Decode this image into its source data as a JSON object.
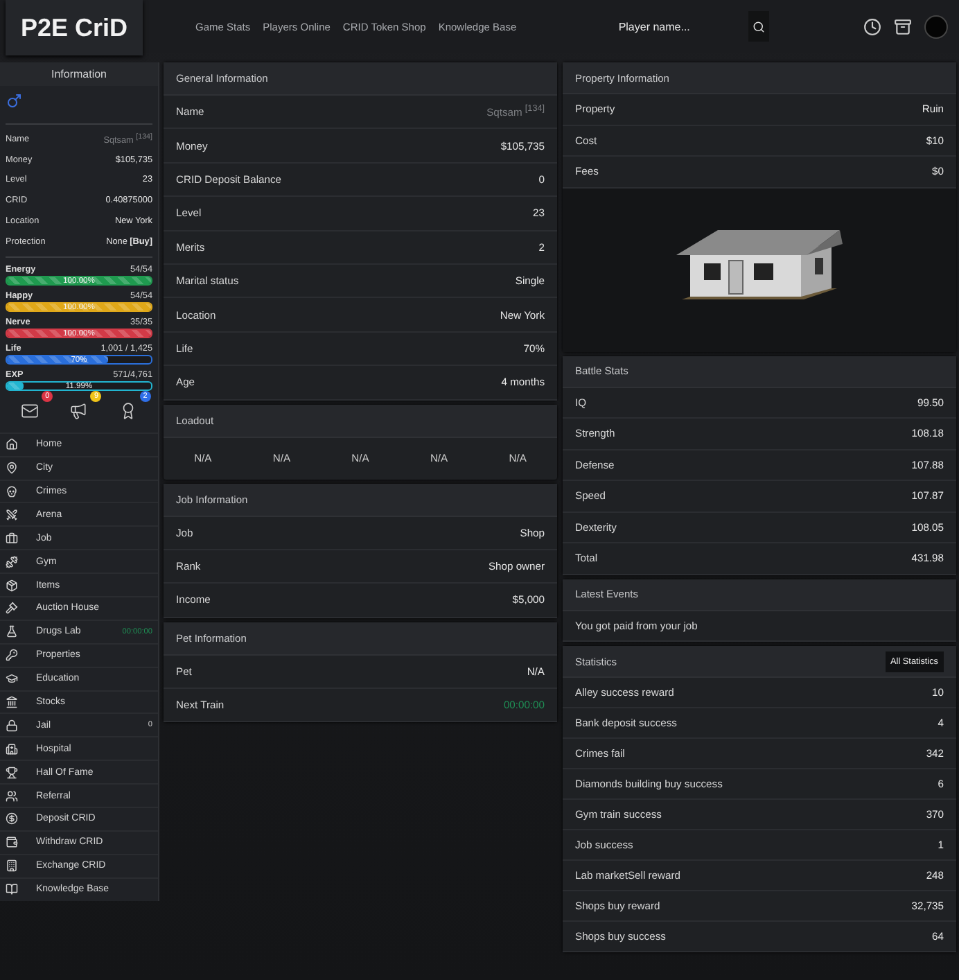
{
  "topbar": {
    "logo": "P2E CriD",
    "nav": [
      "Game Stats",
      "Players Online",
      "CRID Token Shop",
      "Knowledge Base"
    ],
    "search": {
      "placeholder": "Player name..."
    }
  },
  "sidebar": {
    "title": "Information",
    "info": [
      {
        "label": "Name",
        "value": "Sqtsam $^{[134]}$",
        "kind": "muted"
      },
      {
        "label": "Money",
        "value": "$105,735",
        "kind": "plain"
      },
      {
        "label": "Level",
        "value": "23",
        "kind": "plain"
      },
      {
        "label": "CRID",
        "value": "0.40875000",
        "kind": "plain"
      },
      {
        "label": "Location",
        "value": "New York",
        "kind": "plain"
      },
      {
        "label": "Protection",
        "value": "None **[Buy]**",
        "kind": "plain"
      }
    ],
    "bars": [
      {
        "label": "Energy",
        "reading": "54/54",
        "percent": "100.00%",
        "level": 1,
        "color": "#1f9a4f"
      },
      {
        "label": "Happy",
        "reading": "54/54",
        "percent": "100.00%",
        "level": 1,
        "color": "#e0a819"
      },
      {
        "label": "Nerve",
        "reading": "35/35",
        "percent": "100.00%",
        "level": 1,
        "color": "#d23a47"
      },
      {
        "label": "Life",
        "reading": "1,001 / 1,425",
        "percent": "70%",
        "level": 0.7,
        "color": "#2a6fdb"
      },
      {
        "label": "EXP",
        "reading": "571/4,761",
        "percent": "11.99%",
        "level": 0.1199,
        "color": "#22b5d0"
      }
    ],
    "badges": [
      {
        "count": "0",
        "color": "#dc3545"
      },
      {
        "count": "9",
        "color": "#f0c419"
      },
      {
        "count": "2",
        "color": "#2f6fe8"
      }
    ],
    "menu": [
      {
        "label": "Home"
      },
      {
        "label": "City"
      },
      {
        "label": "Crimes"
      },
      {
        "label": "Arena"
      },
      {
        "label": "Job"
      },
      {
        "label": "Gym"
      },
      {
        "label": "Items"
      },
      {
        "label": "Auction House"
      },
      {
        "label": "Drugs Lab",
        "extra": "00:00:00"
      },
      {
        "label": "Properties"
      },
      {
        "label": "Education"
      },
      {
        "label": "Stocks"
      },
      {
        "label": "Jail",
        "extra": "0"
      },
      {
        "label": "Hospital"
      },
      {
        "label": "Hall Of Fame"
      },
      {
        "label": "Referral"
      },
      {
        "label": "Deposit CRID"
      },
      {
        "label": "Withdraw CRID"
      },
      {
        "label": "Exchange CRID"
      },
      {
        "label": "Knowledge Base"
      }
    ]
  },
  "general": {
    "title": "General Information",
    "rows": [
      {
        "label": "Name",
        "value": "Sqtsam $^{[134]}$",
        "kind": "muted"
      },
      {
        "label": "Money",
        "value": "$105,735",
        "kind": "plain"
      },
      {
        "label": "CRID Deposit Balance",
        "value": "0",
        "kind": "plain"
      },
      {
        "label": "Level",
        "value": "23",
        "kind": "plain"
      },
      {
        "label": "Merits",
        "value": "2",
        "kind": "plain"
      },
      {
        "label": "Marital status",
        "value": "Single",
        "kind": "plain"
      },
      {
        "label": "Location",
        "value": "New York",
        "kind": "plain"
      },
      {
        "label": "Life",
        "value": "70%",
        "kind": "plain"
      },
      {
        "label": "Age",
        "value": "4 months",
        "kind": "plain"
      }
    ]
  },
  "loadout": {
    "title": "Loadout",
    "slots": [
      "N/A",
      "N/A",
      "N/A",
      "N/A",
      "N/A"
    ]
  },
  "job": {
    "title": "Job Information",
    "rows": [
      {
        "label": "Job",
        "value": "Shop",
        "kind": "plain"
      },
      {
        "label": "Rank",
        "value": "Shop owner",
        "kind": "plain"
      },
      {
        "label": "Income",
        "value": "$5,000",
        "kind": "plain"
      }
    ]
  },
  "pet": {
    "title": "Pet Information",
    "rows": [
      {
        "label": "Pet",
        "value": "N/A",
        "kind": "plain"
      },
      {
        "label": "Next Train",
        "value": "00:00:00",
        "kind": "timer"
      }
    ]
  },
  "property": {
    "title": "Property Information",
    "rows": [
      {
        "label": "Property",
        "value": "Ruin",
        "kind": "plain"
      },
      {
        "label": "Cost",
        "value": "$10",
        "kind": "plain"
      },
      {
        "label": "Fees",
        "value": "$0",
        "kind": "plain"
      }
    ]
  },
  "battle": {
    "title": "Battle Stats",
    "rows": [
      {
        "label": "IQ",
        "value": "99.50",
        "kind": "plain"
      },
      {
        "label": "Strength",
        "value": "108.18",
        "kind": "plain"
      },
      {
        "label": "Defense",
        "value": "107.88",
        "kind": "plain"
      },
      {
        "label": "Speed",
        "value": "107.87",
        "kind": "plain"
      },
      {
        "label": "Dexterity",
        "value": "108.05",
        "kind": "plain"
      },
      {
        "label": "Total",
        "value": "431.98",
        "kind": "plain"
      }
    ]
  },
  "events": {
    "title": "Latest Events",
    "items": [
      "You got paid from your job"
    ]
  },
  "statistics": {
    "title": "Statistics",
    "button": "All Statistics",
    "rows": [
      {
        "label": "Alley success reward",
        "value": "10",
        "kind": "plain"
      },
      {
        "label": "Bank deposit success",
        "value": "4",
        "kind": "plain"
      },
      {
        "label": "Crimes fail",
        "value": "342",
        "kind": "plain"
      },
      {
        "label": "Diamonds building buy success",
        "value": "6",
        "kind": "plain"
      },
      {
        "label": "Gym train success",
        "value": "370",
        "kind": "plain"
      },
      {
        "label": "Job success",
        "value": "1",
        "kind": "plain"
      },
      {
        "label": "Lab marketSell reward",
        "value": "248",
        "kind": "plain"
      },
      {
        "label": "Shops buy reward",
        "value": "32,735",
        "kind": "plain"
      },
      {
        "label": "Shops buy success",
        "value": "64",
        "kind": "plain"
      }
    ]
  }
}
